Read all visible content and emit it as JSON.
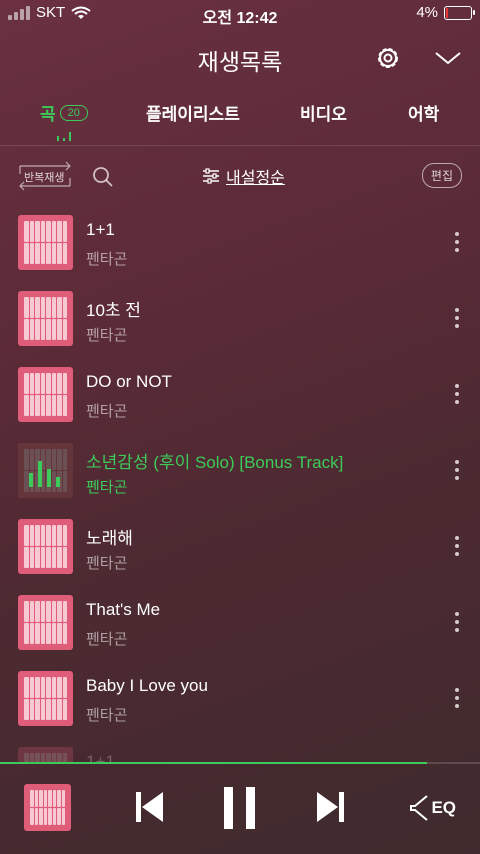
{
  "status": {
    "carrier": "SKT",
    "time": "오전 12:42",
    "battery": "4%",
    "battery_level": 0.04,
    "battery_color": "#e53935"
  },
  "header": {
    "title": "재생목록",
    "settings_icon": "gear-icon",
    "collapse_icon": "chevron-down-icon"
  },
  "tabs": {
    "song_label": "곡",
    "song_count": "20",
    "playlist_label": "플레이리스트",
    "video_label": "비디오",
    "lang_label": "어학"
  },
  "toolbar": {
    "repeat_label": "반복재생",
    "search_icon": "search-icon",
    "sort_label": "내설정순",
    "edit_label": "편집"
  },
  "songs": [
    {
      "title": "1+1",
      "artist": "펜타곤",
      "active": false
    },
    {
      "title": "10초 전",
      "artist": "펜타곤",
      "active": false
    },
    {
      "title": "DO or NOT",
      "artist": "펜타곤",
      "active": false
    },
    {
      "title": "소년감성 (후이 Solo) [Bonus Track]",
      "artist": "펜타곤",
      "active": true
    },
    {
      "title": "노래해",
      "artist": "펜타곤",
      "active": false
    },
    {
      "title": "That's Me",
      "artist": "펜타곤",
      "active": false
    },
    {
      "title": "Baby I Love you",
      "artist": "펜타곤",
      "active": false
    },
    {
      "title": "1+1",
      "artist": "",
      "active": false
    }
  ],
  "player": {
    "progress": 0.89,
    "eq_label": "EQ",
    "accent_color": "#3ccb5a"
  }
}
